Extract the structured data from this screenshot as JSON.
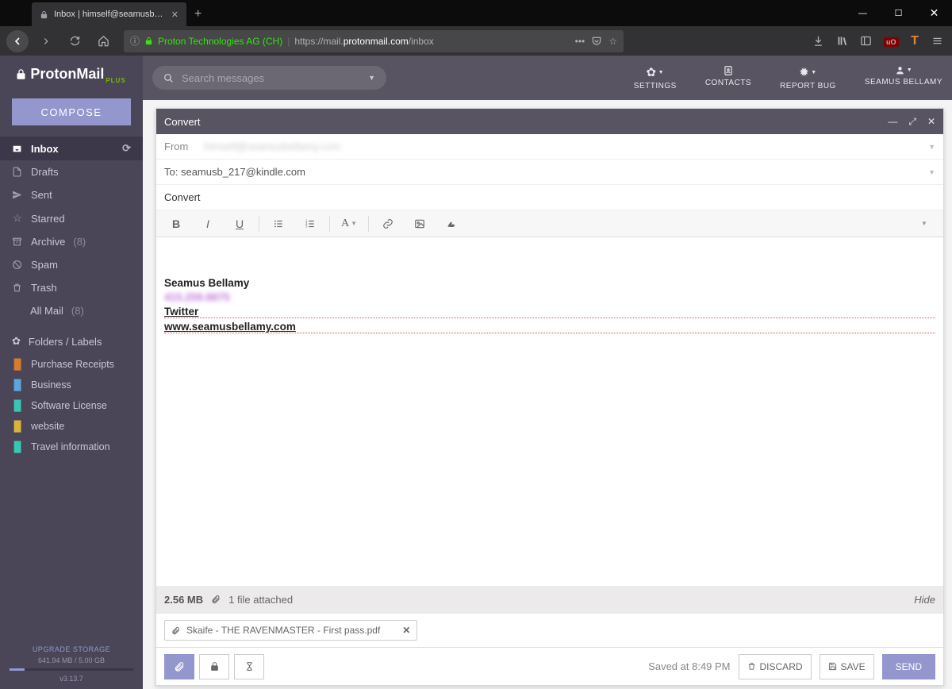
{
  "browser": {
    "tab_title": "Inbox | himself@seamusbellam...",
    "cert_label": "Proton Technologies AG (CH)",
    "url_prefix": "https://mail.",
    "url_domain": "protonmail.com",
    "url_path": "/inbox"
  },
  "brand": {
    "name": "ProtonMail",
    "tier": "PLUS"
  },
  "compose_button": "COMPOSE",
  "search_placeholder": "Search messages",
  "top_actions": {
    "settings": "SETTINGS",
    "contacts": "CONTACTS",
    "report_bug": "REPORT BUG",
    "user": "SEAMUS BELLAMY"
  },
  "sidebar": {
    "inbox": "Inbox",
    "drafts": "Drafts",
    "sent": "Sent",
    "starred": "Starred",
    "archive": "Archive",
    "archive_count": "(8)",
    "spam": "Spam",
    "trash": "Trash",
    "all_mail": "All Mail",
    "all_mail_count": "(8)",
    "section_label": "Folders / Labels",
    "folders": [
      {
        "label": "Purchase Receipts",
        "color": "#d97a2e"
      },
      {
        "label": "Business",
        "color": "#5ba7dd"
      },
      {
        "label": "Software License",
        "color": "#38c7b4"
      },
      {
        "label": "website",
        "color": "#d9b63a"
      },
      {
        "label": "Travel information",
        "color": "#38c7b4"
      }
    ],
    "upgrade": "UPGRADE STORAGE",
    "storage": "641.94 MB / 5.00 GB",
    "version": "v3.13.7"
  },
  "compose": {
    "title": "Convert",
    "from_label": "From",
    "from_value": "himself@seamusbellamy.com",
    "to_label": "To:",
    "to_value": "seamusb_217@kindle.com",
    "subject": "Convert",
    "body": {
      "name": "Seamus Bellamy",
      "redacted": "415.259.8875",
      "twitter": "Twitter",
      "website": "www.seamusbellamy.com"
    },
    "attachment_size": "2.56 MB",
    "attachment_count": "1 file attached",
    "hide": "Hide",
    "attachment_name": "Skaife - THE RAVENMASTER - First pass.pdf",
    "saved_text": "Saved at 8:49 PM",
    "discard": "DISCARD",
    "save": "SAVE",
    "send": "SEND"
  }
}
